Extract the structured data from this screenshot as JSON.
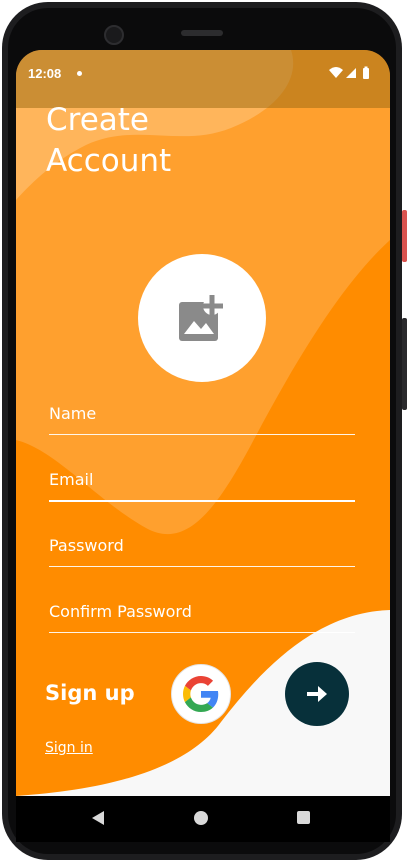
{
  "status_bar": {
    "time": "12:08"
  },
  "header": {
    "title_line1": "Create",
    "title_line2": "Account"
  },
  "avatar": {
    "icon": "add-photo-icon"
  },
  "form": {
    "fields": [
      {
        "label": "Name"
      },
      {
        "label": "Email"
      },
      {
        "label": "Password"
      },
      {
        "label": "Confirm Password"
      }
    ]
  },
  "actions": {
    "signup_label": "Sign up",
    "signin_label": "Sign in",
    "google_icon": "google-icon",
    "next_icon": "arrow-right-icon"
  },
  "colors": {
    "background": "#ff8c00",
    "accent_dark": "#07303a",
    "white": "#ffffff",
    "bottom_shape": "#f8f8f8"
  },
  "nav_bar": {
    "back_icon": "back-icon",
    "home_icon": "home-icon",
    "recents_icon": "recents-icon"
  }
}
